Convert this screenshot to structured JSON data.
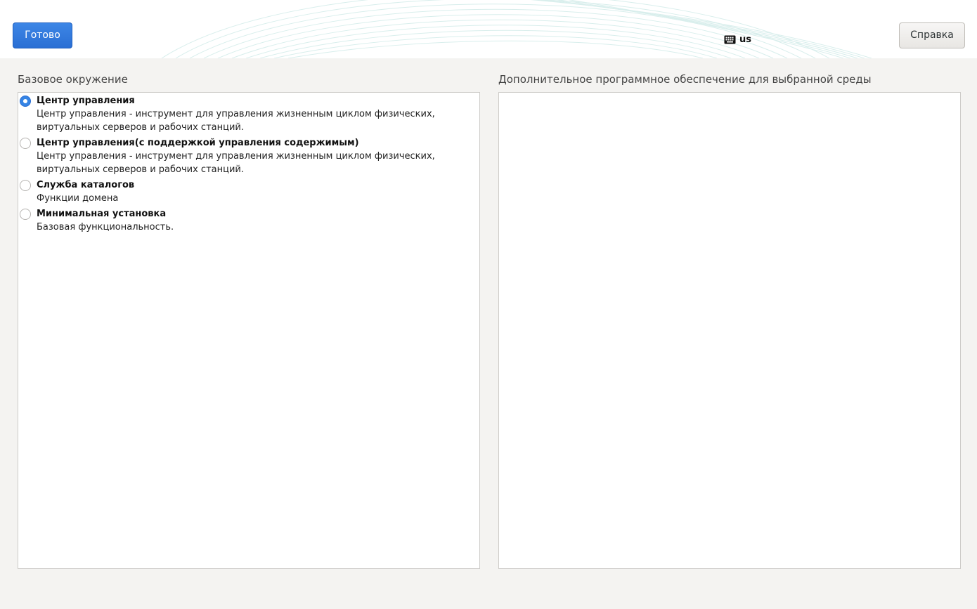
{
  "header": {
    "done_label": "Готово",
    "help_label": "Справка",
    "keyboard_layout": "us",
    "accent_color": "#3584e4"
  },
  "base_environment": {
    "title": "Базовое окружение",
    "items": [
      {
        "name": "Центр управления",
        "description": "Центр управления - инструмент для управления жизненным циклом физических, виртуальных серверов и рабочих станций.",
        "selected": true
      },
      {
        "name": "Центр управления(с поддержкой управления содержимым)",
        "description": "Центр управления - инструмент для управления жизненным циклом физических, виртуальных серверов и рабочих станций.",
        "selected": false
      },
      {
        "name": "Служба каталогов",
        "description": "Функции домена",
        "selected": false
      },
      {
        "name": "Минимальная установка",
        "description": "Базовая функциональность.",
        "selected": false
      }
    ]
  },
  "addons": {
    "title": "Дополнительное программное обеспечение для выбранной среды",
    "items": []
  }
}
